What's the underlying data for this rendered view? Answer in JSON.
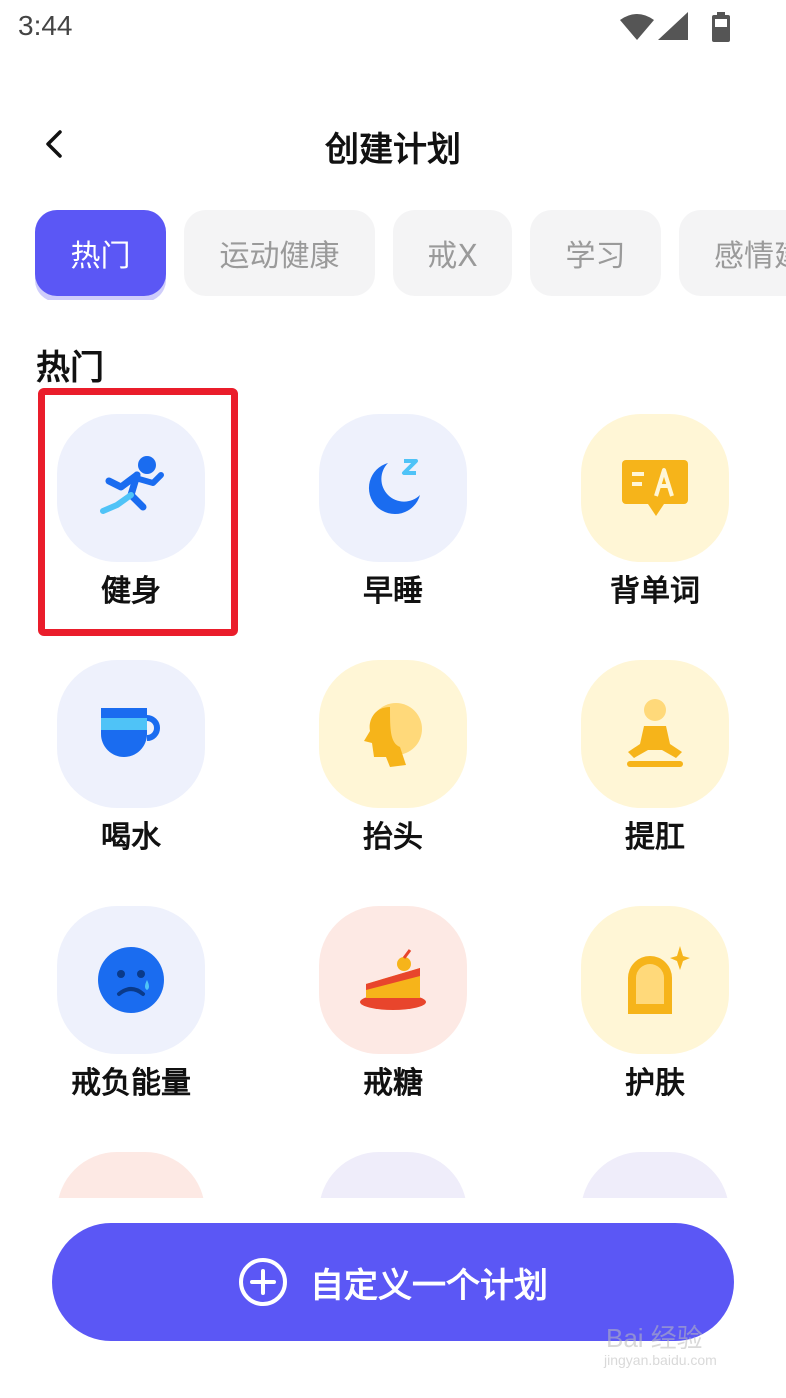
{
  "status_bar": {
    "time": "3:44",
    "icons": [
      "wifi-icon",
      "signal-icon",
      "battery-icon"
    ]
  },
  "header": {
    "title": "创建计划",
    "back_icon": "chevron-left-icon"
  },
  "tabs": [
    {
      "label": "热门",
      "active": true
    },
    {
      "label": "运动健康",
      "active": false
    },
    {
      "label": "戒X",
      "active": false
    },
    {
      "label": "学习",
      "active": false
    },
    {
      "label": "感情建",
      "active": false
    }
  ],
  "section": {
    "title": "热门"
  },
  "items": [
    {
      "label": "健身",
      "icon": "running-person-icon",
      "tint": "blue",
      "highlighted": true
    },
    {
      "label": "早睡",
      "icon": "moon-sleep-icon",
      "tint": "blue"
    },
    {
      "label": "背单词",
      "icon": "translate-card-icon",
      "tint": "yellow"
    },
    {
      "label": "喝水",
      "icon": "cup-icon",
      "tint": "blue"
    },
    {
      "label": "抬头",
      "icon": "head-profile-icon",
      "tint": "yellow"
    },
    {
      "label": "提肛",
      "icon": "meditation-icon",
      "tint": "yellow"
    },
    {
      "label": "戒负能量",
      "icon": "sad-face-icon",
      "tint": "blue"
    },
    {
      "label": "戒糖",
      "icon": "cake-icon",
      "tint": "pink"
    },
    {
      "label": "护肤",
      "icon": "face-sparkle-icon",
      "tint": "yellow"
    }
  ],
  "cta": {
    "label": "自定义一个计划",
    "icon": "plus-circle-icon"
  },
  "watermark": {
    "text": "Bai 经验",
    "sub": "jingyan.baidu.com"
  },
  "colors": {
    "accent": "#5b57f5",
    "highlight": "#ea1d2b",
    "icon_blue": "#1a6cf0",
    "icon_yellow": "#f6b41a"
  }
}
